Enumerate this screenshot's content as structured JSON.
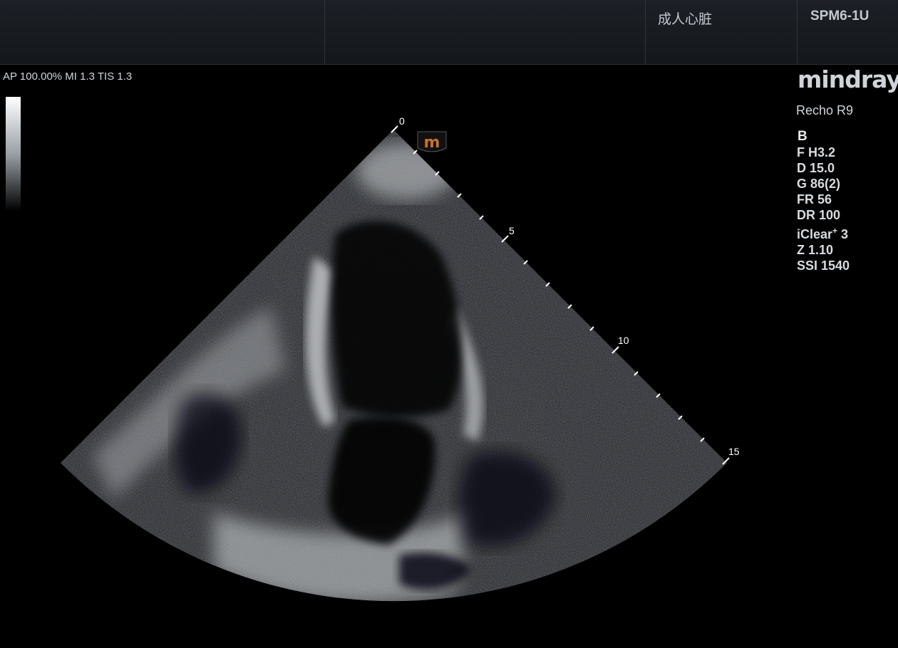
{
  "header": {
    "exam_preset": "成人心脏",
    "probe": "SPM6-1U"
  },
  "acoustic_power": "AP 100.00%  MI 1.3 TIS 1.3",
  "brand": {
    "logo": "mindray",
    "model": "Recho R9"
  },
  "imaging_mode": "B",
  "parameters": {
    "frequency": "F H3.2",
    "depth": "D 15.0",
    "gain": "G 86(2)",
    "frame_rate": "FR 56",
    "dynamic_range": "DR 100",
    "iclear_name": "iClear",
    "iclear_sup": "+",
    "iclear_value": " 3",
    "zoom": "Z 1.10",
    "ssi": "SSI 1540"
  },
  "depth_scale": {
    "labels": [
      "0",
      "5",
      "10",
      "15"
    ]
  },
  "orientation_marker": "m",
  "colors": {
    "marker_orange": "#c8702a",
    "scale_ticks": "#ffffff"
  }
}
